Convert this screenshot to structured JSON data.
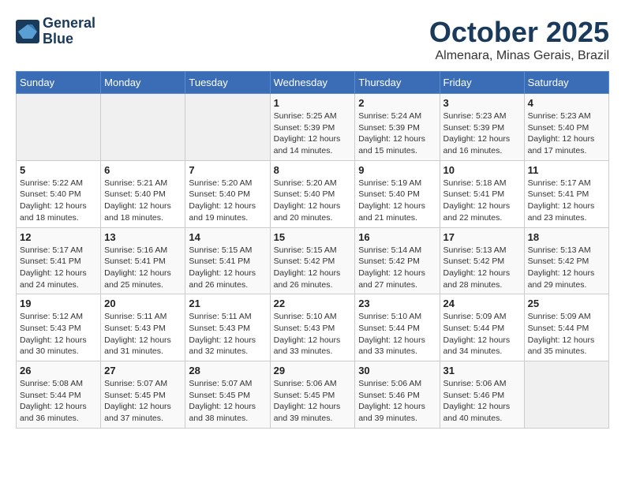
{
  "header": {
    "logo_line1": "General",
    "logo_line2": "Blue",
    "month": "October 2025",
    "location": "Almenara, Minas Gerais, Brazil"
  },
  "days_of_week": [
    "Sunday",
    "Monday",
    "Tuesday",
    "Wednesday",
    "Thursday",
    "Friday",
    "Saturday"
  ],
  "weeks": [
    [
      {
        "num": "",
        "info": ""
      },
      {
        "num": "",
        "info": ""
      },
      {
        "num": "",
        "info": ""
      },
      {
        "num": "1",
        "info": "Sunrise: 5:25 AM\nSunset: 5:39 PM\nDaylight: 12 hours\nand 14 minutes."
      },
      {
        "num": "2",
        "info": "Sunrise: 5:24 AM\nSunset: 5:39 PM\nDaylight: 12 hours\nand 15 minutes."
      },
      {
        "num": "3",
        "info": "Sunrise: 5:23 AM\nSunset: 5:39 PM\nDaylight: 12 hours\nand 16 minutes."
      },
      {
        "num": "4",
        "info": "Sunrise: 5:23 AM\nSunset: 5:40 PM\nDaylight: 12 hours\nand 17 minutes."
      }
    ],
    [
      {
        "num": "5",
        "info": "Sunrise: 5:22 AM\nSunset: 5:40 PM\nDaylight: 12 hours\nand 18 minutes."
      },
      {
        "num": "6",
        "info": "Sunrise: 5:21 AM\nSunset: 5:40 PM\nDaylight: 12 hours\nand 18 minutes."
      },
      {
        "num": "7",
        "info": "Sunrise: 5:20 AM\nSunset: 5:40 PM\nDaylight: 12 hours\nand 19 minutes."
      },
      {
        "num": "8",
        "info": "Sunrise: 5:20 AM\nSunset: 5:40 PM\nDaylight: 12 hours\nand 20 minutes."
      },
      {
        "num": "9",
        "info": "Sunrise: 5:19 AM\nSunset: 5:40 PM\nDaylight: 12 hours\nand 21 minutes."
      },
      {
        "num": "10",
        "info": "Sunrise: 5:18 AM\nSunset: 5:41 PM\nDaylight: 12 hours\nand 22 minutes."
      },
      {
        "num": "11",
        "info": "Sunrise: 5:17 AM\nSunset: 5:41 PM\nDaylight: 12 hours\nand 23 minutes."
      }
    ],
    [
      {
        "num": "12",
        "info": "Sunrise: 5:17 AM\nSunset: 5:41 PM\nDaylight: 12 hours\nand 24 minutes."
      },
      {
        "num": "13",
        "info": "Sunrise: 5:16 AM\nSunset: 5:41 PM\nDaylight: 12 hours\nand 25 minutes."
      },
      {
        "num": "14",
        "info": "Sunrise: 5:15 AM\nSunset: 5:41 PM\nDaylight: 12 hours\nand 26 minutes."
      },
      {
        "num": "15",
        "info": "Sunrise: 5:15 AM\nSunset: 5:42 PM\nDaylight: 12 hours\nand 26 minutes."
      },
      {
        "num": "16",
        "info": "Sunrise: 5:14 AM\nSunset: 5:42 PM\nDaylight: 12 hours\nand 27 minutes."
      },
      {
        "num": "17",
        "info": "Sunrise: 5:13 AM\nSunset: 5:42 PM\nDaylight: 12 hours\nand 28 minutes."
      },
      {
        "num": "18",
        "info": "Sunrise: 5:13 AM\nSunset: 5:42 PM\nDaylight: 12 hours\nand 29 minutes."
      }
    ],
    [
      {
        "num": "19",
        "info": "Sunrise: 5:12 AM\nSunset: 5:43 PM\nDaylight: 12 hours\nand 30 minutes."
      },
      {
        "num": "20",
        "info": "Sunrise: 5:11 AM\nSunset: 5:43 PM\nDaylight: 12 hours\nand 31 minutes."
      },
      {
        "num": "21",
        "info": "Sunrise: 5:11 AM\nSunset: 5:43 PM\nDaylight: 12 hours\nand 32 minutes."
      },
      {
        "num": "22",
        "info": "Sunrise: 5:10 AM\nSunset: 5:43 PM\nDaylight: 12 hours\nand 33 minutes."
      },
      {
        "num": "23",
        "info": "Sunrise: 5:10 AM\nSunset: 5:44 PM\nDaylight: 12 hours\nand 33 minutes."
      },
      {
        "num": "24",
        "info": "Sunrise: 5:09 AM\nSunset: 5:44 PM\nDaylight: 12 hours\nand 34 minutes."
      },
      {
        "num": "25",
        "info": "Sunrise: 5:09 AM\nSunset: 5:44 PM\nDaylight: 12 hours\nand 35 minutes."
      }
    ],
    [
      {
        "num": "26",
        "info": "Sunrise: 5:08 AM\nSunset: 5:44 PM\nDaylight: 12 hours\nand 36 minutes."
      },
      {
        "num": "27",
        "info": "Sunrise: 5:07 AM\nSunset: 5:45 PM\nDaylight: 12 hours\nand 37 minutes."
      },
      {
        "num": "28",
        "info": "Sunrise: 5:07 AM\nSunset: 5:45 PM\nDaylight: 12 hours\nand 38 minutes."
      },
      {
        "num": "29",
        "info": "Sunrise: 5:06 AM\nSunset: 5:45 PM\nDaylight: 12 hours\nand 39 minutes."
      },
      {
        "num": "30",
        "info": "Sunrise: 5:06 AM\nSunset: 5:46 PM\nDaylight: 12 hours\nand 39 minutes."
      },
      {
        "num": "31",
        "info": "Sunrise: 5:06 AM\nSunset: 5:46 PM\nDaylight: 12 hours\nand 40 minutes."
      },
      {
        "num": "",
        "info": ""
      }
    ]
  ]
}
